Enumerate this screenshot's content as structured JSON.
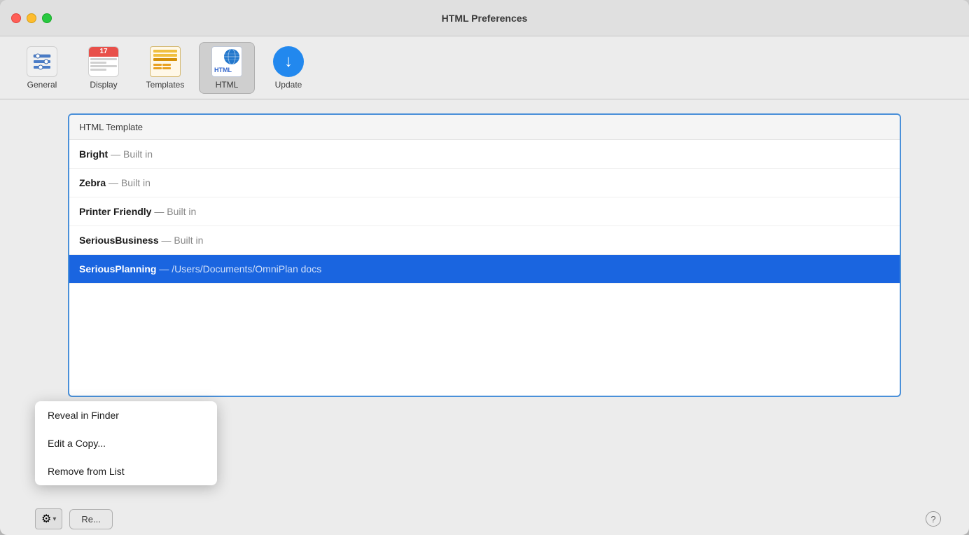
{
  "window": {
    "title": "HTML Preferences"
  },
  "toolbar": {
    "items": [
      {
        "id": "general",
        "label": "General",
        "icon": "general-icon"
      },
      {
        "id": "display",
        "label": "Display",
        "icon": "display-icon",
        "day": "17"
      },
      {
        "id": "templates",
        "label": "Templates",
        "icon": "templates-icon"
      },
      {
        "id": "html",
        "label": "HTML",
        "icon": "html-icon",
        "active": true
      },
      {
        "id": "update",
        "label": "Update",
        "icon": "update-icon"
      }
    ]
  },
  "list": {
    "header": "HTML Template",
    "items": [
      {
        "id": "bright",
        "name": "Bright",
        "subtitle": "— Built in"
      },
      {
        "id": "zebra",
        "name": "Zebra",
        "subtitle": "— Built in"
      },
      {
        "id": "printer-friendly",
        "name": "Printer Friendly",
        "subtitle": "— Built in"
      },
      {
        "id": "serious-business",
        "name": "SeriousBusiness",
        "subtitle": "— Built in"
      },
      {
        "id": "serious-planning",
        "name": "SeriousPlanning",
        "subtitle": "— /Users/Documents/OmniPlan docs",
        "selected": true
      }
    ]
  },
  "bottom": {
    "gear_label": "⚙",
    "chevron_label": "▾",
    "revert_label": "Re..."
  },
  "dropdown": {
    "items": [
      {
        "id": "reveal-finder",
        "label": "Reveal in Finder"
      },
      {
        "id": "edit-copy",
        "label": "Edit a Copy..."
      },
      {
        "id": "remove-list",
        "label": "Remove from List"
      }
    ]
  },
  "help": {
    "label": "?"
  }
}
